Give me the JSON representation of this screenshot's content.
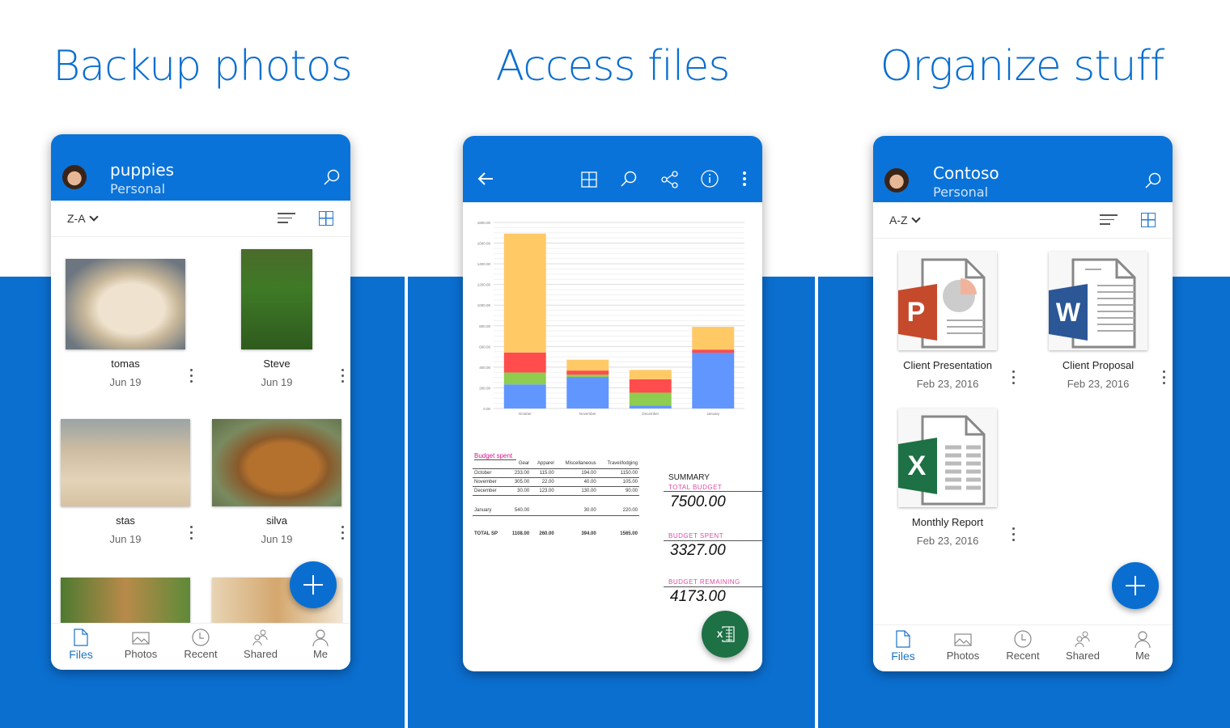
{
  "headlines": [
    "Backup photos",
    "Access files",
    "Organize stuff"
  ],
  "colors": {
    "brand_blue": "#0a73d9",
    "headline_blue": "#0a6ed1",
    "excel_green": "#1d7145",
    "ppt_red": "#c5492b",
    "word_blue": "#2b5797"
  },
  "phone1": {
    "header": {
      "title": "puppies",
      "subtitle": "Personal",
      "avatar": "avatar-icon",
      "search": "search-icon"
    },
    "sort_label": "Z-A",
    "view_icons": [
      "list-view-icon",
      "grid-view-icon"
    ],
    "items": [
      {
        "name": "tomas",
        "date": "Jun 19"
      },
      {
        "name": "Steve",
        "date": "Jun 19"
      },
      {
        "name": "stas",
        "date": "Jun 19"
      },
      {
        "name": "silva",
        "date": "Jun 19"
      }
    ],
    "fab": "add-icon",
    "nav": [
      {
        "label": "Files",
        "icon": "file-icon",
        "active": true
      },
      {
        "label": "Photos",
        "icon": "photo-icon"
      },
      {
        "label": "Recent",
        "icon": "clock-icon"
      },
      {
        "label": "Shared",
        "icon": "people-icon"
      },
      {
        "label": "Me",
        "icon": "person-icon"
      }
    ]
  },
  "phone2": {
    "toolbar_icons": [
      "back-arrow-icon",
      "grid-icon",
      "search-icon",
      "share-icon",
      "info-icon",
      "more-vertical-icon"
    ],
    "budget_table": {
      "title": "Budget spent",
      "headers": [
        "",
        "Gear",
        "Apparel",
        "Miscellaneous",
        "Travel/lodging"
      ],
      "rows": [
        [
          "October",
          "233.00",
          "115.00",
          "194.00",
          "1150.00"
        ],
        [
          "November",
          "305.00",
          "22.00",
          "40.00",
          "105.00"
        ],
        [
          "December",
          "30.00",
          "123.00",
          "130.00",
          "90.00"
        ],
        [
          "",
          "",
          "",
          "",
          ""
        ],
        [
          "January",
          "540.00",
          "",
          "30.00",
          "220.00"
        ],
        [
          "",
          "",
          "",
          "",
          ""
        ],
        [
          "TOTAL SP",
          "1108.00",
          "260.00",
          "394.00",
          "1565.00"
        ]
      ]
    },
    "summary": {
      "heading": "SUMMARY",
      "total_label": "TOTAL BUDGET",
      "total_value": "7500.00",
      "spent_label": "BUDGET SPENT",
      "spent_value": "3327.00",
      "remaining_label": "BUDGET REMAINING",
      "remaining_value": "4173.00"
    },
    "fab": "excel-icon"
  },
  "chart_data": {
    "type": "bar",
    "stacked": true,
    "categories": [
      "October",
      "November",
      "December",
      "January"
    ],
    "series": [
      {
        "name": "Gear",
        "color": "#6196ff",
        "values": [
          233,
          305,
          30,
          540
        ]
      },
      {
        "name": "Apparel",
        "color": "#8ecd4f",
        "values": [
          115,
          22,
          123,
          0
        ]
      },
      {
        "name": "Miscellaneous",
        "color": "#ff4d4d",
        "values": [
          194,
          40,
          130,
          30
        ]
      },
      {
        "name": "Travel/lodging",
        "color": "#ffc966",
        "values": [
          1150,
          105,
          90,
          220
        ]
      }
    ],
    "yticks": [
      "0.00",
      "200.00",
      "400.00",
      "600.00",
      "800.00",
      "1000.00",
      "1200.00",
      "1400.00",
      "1600.00",
      "1800.00"
    ],
    "ylim": [
      0,
      1800
    ],
    "grid": true,
    "title": "",
    "xlabel": "",
    "ylabel": ""
  },
  "phone3": {
    "header": {
      "title": "Contoso",
      "subtitle": "Personal"
    },
    "sort_label": "A-Z",
    "items": [
      {
        "name": "Client Presentation",
        "date": "Feb 23, 2016",
        "type": "powerpoint-icon",
        "letter": "P"
      },
      {
        "name": "Client Proposal",
        "date": "Feb 23, 2016",
        "type": "word-icon",
        "letter": "W"
      },
      {
        "name": "Monthly Report",
        "date": "Feb 23, 2016",
        "type": "excel-icon",
        "letter": "X"
      }
    ],
    "nav": [
      {
        "label": "Files",
        "active": true
      },
      {
        "label": "Photos"
      },
      {
        "label": "Recent"
      },
      {
        "label": "Shared"
      },
      {
        "label": "Me"
      }
    ]
  }
}
